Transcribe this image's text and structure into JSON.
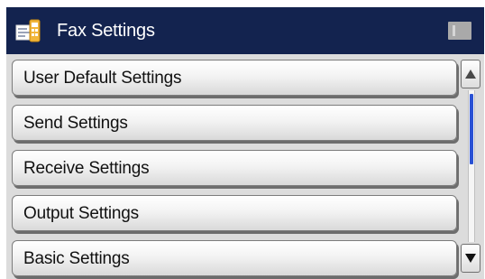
{
  "header": {
    "title": "Fax Settings",
    "icon": "fax-settings-icon",
    "status_icon": "status-indicator-icon"
  },
  "menu": {
    "items": [
      {
        "label": "User Default Settings"
      },
      {
        "label": "Send Settings"
      },
      {
        "label": "Receive Settings"
      },
      {
        "label": "Output Settings"
      },
      {
        "label": "Basic Settings"
      }
    ]
  },
  "scrollbar": {
    "up_icon": "arrow-up-icon",
    "down_icon": "arrow-down-icon",
    "thumb_color": "#2a52d4",
    "position_fraction": 0.0,
    "visible_fraction": 0.46
  },
  "colors": {
    "titlebar": "#13234f",
    "title_text": "#ffffff",
    "panel": "#dcdcdc"
  }
}
